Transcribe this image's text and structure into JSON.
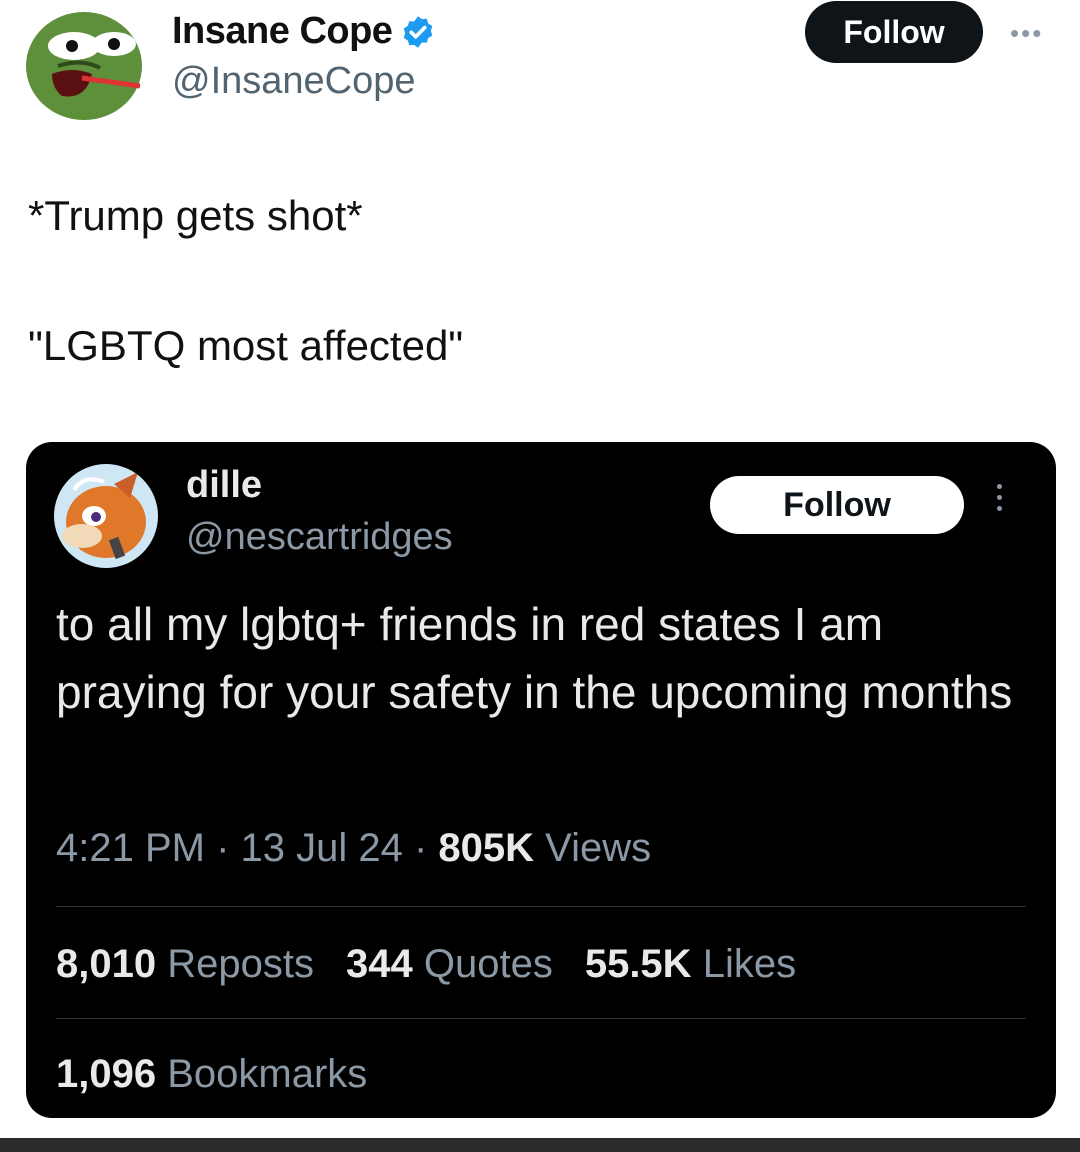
{
  "outer_tweet": {
    "author_name": "Insane Cope",
    "author_handle": "@InsaneCope",
    "avatar_icon": "pepe-frog-avatar",
    "verified_icon": "verified-badge-icon",
    "verified_color": "#1d9bf0",
    "follow_label": "Follow",
    "more_icon": "more-horizontal-icon",
    "text_line_1": "*Trump gets shot*",
    "text_line_2": "\"LGBTQ most affected\""
  },
  "quoted_tweet": {
    "author_name": "dille",
    "author_handle": "@nescartridges",
    "avatar_icon": "cartoon-character-avatar",
    "follow_label": "Follow",
    "more_icon": "more-vertical-icon",
    "text": "to all my lgbtq+ friends in red states I am praying for your safety in the upcoming months",
    "time": "4:21 PM",
    "date": "13 Jul 24",
    "views_count": "805K",
    "views_label": "Views",
    "reposts_count": "8,010",
    "reposts_label": "Reposts",
    "quotes_count": "344",
    "quotes_label": "Quotes",
    "likes_count": "55.5K",
    "likes_label": "Likes",
    "bookmarks_count": "1,096",
    "bookmarks_label": "Bookmarks"
  }
}
